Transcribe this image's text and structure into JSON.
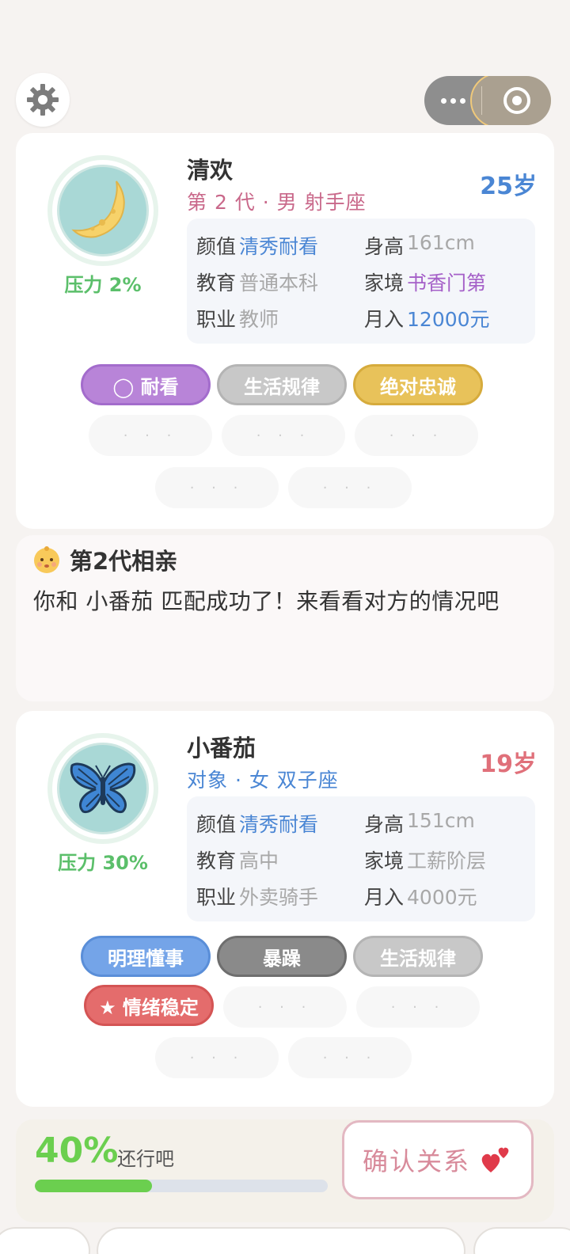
{
  "header": {
    "settings_icon": "gear-icon",
    "capsule_menu_icon": "more-dots-icon",
    "capsule_close_icon": "target-circle-icon"
  },
  "player": {
    "name": "清欢",
    "subtitle": "第 2 代 · 男 射手座",
    "age": "25岁",
    "pressure": "压力 2%",
    "avatar_icon": "crescent-moon-icon",
    "info": {
      "looks_label": "颜值",
      "looks_value": "清秀耐看",
      "height_label": "身高",
      "height_value": "161cm",
      "edu_label": "教育",
      "edu_value": "普通本科",
      "family_label": "家境",
      "family_value": "书香门第",
      "job_label": "职业",
      "job_value": "教师",
      "income_label": "月入",
      "income_value": "12000元"
    },
    "tags": [
      "◯ 耐看",
      "生活规律",
      "绝对忠诚"
    ],
    "placeholder": "· · ·"
  },
  "match": {
    "title": "第2代相亲",
    "icon": "baby-face-icon",
    "text": "你和 小番茄 匹配成功了！来看看对方的情况吧"
  },
  "partner": {
    "name": "小番茄",
    "subtitle": "对象 · 女 双子座",
    "age": "19岁",
    "pressure": "压力 30%",
    "avatar_icon": "butterfly-icon",
    "info": {
      "looks_label": "颜值",
      "looks_value": "清秀耐看",
      "height_label": "身高",
      "height_value": "151cm",
      "edu_label": "教育",
      "edu_value": "高中",
      "family_label": "家境",
      "family_value": "工薪阶层",
      "job_label": "职业",
      "job_value": "外卖骑手",
      "income_label": "月入",
      "income_value": "4000元"
    },
    "tags": [
      "明理懂事",
      "暴躁",
      "生活规律",
      "★ 情绪稳定"
    ],
    "placeholder": "· · ·"
  },
  "affinity": {
    "percent_label": "40%",
    "progress": 0.4,
    "note": "还行吧",
    "confirm_label": "确认关系",
    "confirm_icon": "hearts-icon"
  },
  "colors": {
    "pressure_green": "#5bbf6a",
    "blue": "#4a86d4",
    "purple": "#a560c8",
    "gray_value": "#a8a8a8",
    "male_sub": "#c9688a",
    "female_sub": "#4a86d4",
    "age_male": "#4a86d4",
    "age_female": "#e0707a",
    "tag_purple": "#b884d8",
    "tag_gray": "#c8c8c8",
    "tag_gold": "#e8c25a",
    "tag_blue": "#74a4e8",
    "tag_dark": "#8a8a8a",
    "tag_red": "#e46c6c"
  }
}
